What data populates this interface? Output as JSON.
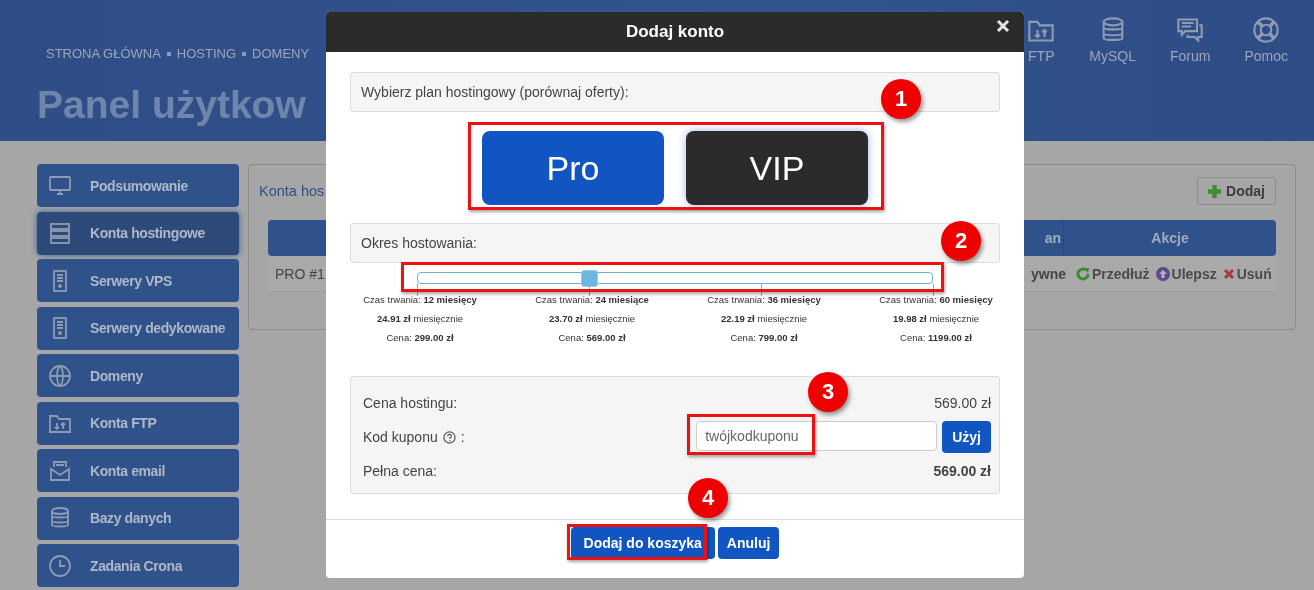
{
  "header": {
    "nav": [
      "STRONA GŁÓWNA",
      "HOSTING",
      "DOMENY"
    ],
    "title": "Panel użytkow",
    "shortcuts": [
      {
        "label": "FTP",
        "kind": "folder"
      },
      {
        "label": "MySQL",
        "kind": "database"
      },
      {
        "label": "Forum",
        "kind": "chat"
      },
      {
        "label": "Pomoc",
        "kind": "lifebuoy"
      }
    ]
  },
  "sidebar": {
    "items": [
      {
        "label": "Podsumowanie",
        "kind": "monitor",
        "selected": false
      },
      {
        "label": "Konta hostingowe",
        "kind": "servers",
        "selected": true
      },
      {
        "label": "Serwery VPS",
        "kind": "tower",
        "selected": false
      },
      {
        "label": "Serwery dedykowane",
        "kind": "tower",
        "selected": false
      },
      {
        "label": "Domeny",
        "kind": "globe",
        "selected": false
      },
      {
        "label": "Konta FTP",
        "kind": "folder",
        "selected": false
      },
      {
        "label": "Konta email",
        "kind": "mail",
        "selected": false
      },
      {
        "label": "Bazy danych",
        "kind": "database",
        "selected": false
      },
      {
        "label": "Zadania Crona",
        "kind": "clock",
        "selected": false
      }
    ]
  },
  "panel": {
    "title": "Konta hos",
    "add_button": "Dodaj",
    "table": {
      "columns": [
        "an",
        "Akcje"
      ],
      "rows": [
        {
          "name": "PRO #1",
          "status": "ywne",
          "actions": [
            {
              "label": "Przedłuż",
              "kind": "renew"
            },
            {
              "label": "Ulepsz",
              "kind": "upgrade"
            },
            {
              "label": "Usuń",
              "kind": "delete"
            }
          ]
        }
      ]
    }
  },
  "dialog": {
    "title": "Dodaj konto",
    "plan_prompt": "Wybierz plan hostingowy (porównaj oferty):",
    "plans": [
      {
        "label": "Pro",
        "selected": true
      },
      {
        "label": "VIP",
        "selected": false
      }
    ],
    "period_prompt": "Okres hostowania:",
    "period_slider": {
      "level": 0.333
    },
    "durations": [
      {
        "duration": "Czas trwania: **12 miesięcy**",
        "monthly": "**24.91 zł** miesięcznie",
        "price": "Cena: **299.00 zł**"
      },
      {
        "duration": "Czas trwania: **24 miesiące**",
        "monthly": "**23.70 zł** miesięcznie",
        "price": "Cena: **569.00 zł**"
      },
      {
        "duration": "Czas trwania: **36 miesięcy**",
        "monthly": "**22.19 zł** miesięcznie",
        "price": "Cena: **799.00 zł**"
      },
      {
        "duration": "Czas trwania: **60 miesięcy**",
        "monthly": "**19.98 zł** miesięcznie",
        "price": "Cena: **1199.00 zł**"
      }
    ],
    "summary": {
      "hosting_price_label": "Cena hostingu:",
      "hosting_price": "569.00 zł",
      "coupon_label": "Kod kuponu",
      "coupon_colon": ":",
      "coupon_placeholder": "twójkodkuponu",
      "apply_button": "Użyj",
      "total_label": "Pełna cena:",
      "total": "569.00 zł"
    },
    "buttons": [
      {
        "label": "Dodaj do koszyka",
        "kind": "primary"
      },
      {
        "label": "Anuluj",
        "kind": "secondary"
      }
    ]
  },
  "annotations": [
    {
      "label": "1"
    },
    {
      "label": "2"
    },
    {
      "label": "3"
    },
    {
      "label": "4"
    }
  ]
}
